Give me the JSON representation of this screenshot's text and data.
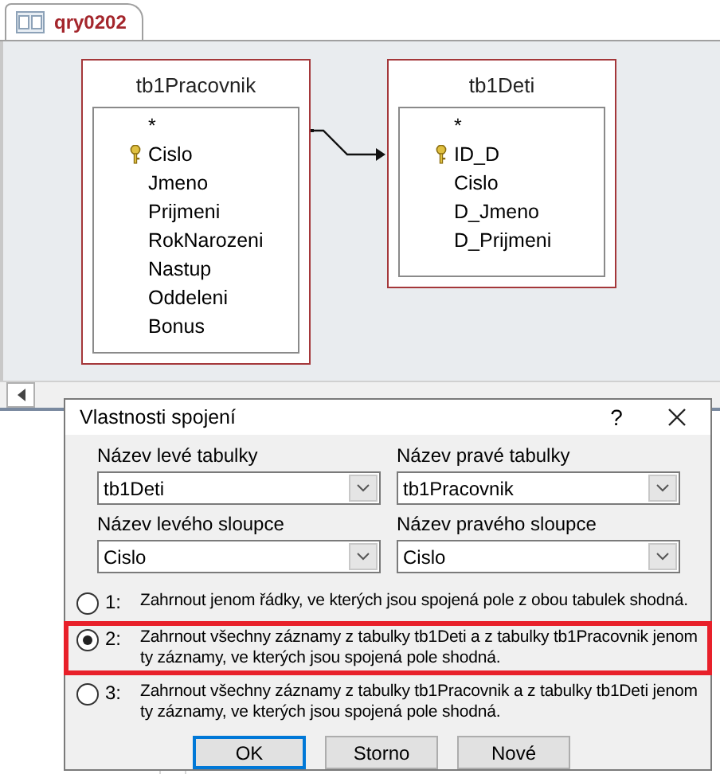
{
  "tab": {
    "title": "qry0202",
    "selected": true
  },
  "tables": [
    {
      "name": "tb1Pracovnik",
      "fields": [
        {
          "name": "*",
          "key": false
        },
        {
          "name": "Cislo",
          "key": true
        },
        {
          "name": "Jmeno",
          "key": false
        },
        {
          "name": "Prijmeni",
          "key": false
        },
        {
          "name": "RokNarozeni",
          "key": false
        },
        {
          "name": "Nastup",
          "key": false
        },
        {
          "name": "Oddeleni",
          "key": false
        },
        {
          "name": "Bonus",
          "key": false
        }
      ]
    },
    {
      "name": "tb1Deti",
      "fields": [
        {
          "name": "*",
          "key": false
        },
        {
          "name": "ID_D",
          "key": true
        },
        {
          "name": "Cislo",
          "key": false
        },
        {
          "name": "D_Jmeno",
          "key": false
        },
        {
          "name": "D_Prijmeni",
          "key": false
        }
      ]
    }
  ],
  "dialog": {
    "title": "Vlastnosti spojení",
    "help": "?",
    "combos": [
      {
        "label": "Název levé tabulky",
        "value": "tb1Deti"
      },
      {
        "label": "Název pravé tabulky",
        "value": "tb1Pracovnik"
      },
      {
        "label": "Název levého sloupce",
        "value": "Cislo"
      },
      {
        "label": "Název pravého sloupce",
        "value": "Cislo"
      }
    ],
    "options": [
      {
        "number": "1:",
        "text": "Zahrnout jenom řádky, ve kterých jsou spojená pole z obou tabulek shodná.",
        "selected": false,
        "highlighted": false
      },
      {
        "number": "2:",
        "text": "Zahrnout všechny záznamy z tabulky tb1Deti a z tabulky tb1Pracovnik jenom ty záznamy, ve kterých jsou spojená pole shodná.",
        "selected": true,
        "highlighted": true
      },
      {
        "number": "3:",
        "text": "Zahrnout všechny záznamy z tabulky tb1Pracovnik a z tabulky tb1Deti jenom ty záznamy, ve kterých jsou spojená pole shodná.",
        "selected": false,
        "highlighted": false
      }
    ],
    "buttons": [
      {
        "label": "OK",
        "default": true
      },
      {
        "label": "Storno",
        "default": false
      },
      {
        "label": "Nové",
        "default": false
      }
    ]
  }
}
